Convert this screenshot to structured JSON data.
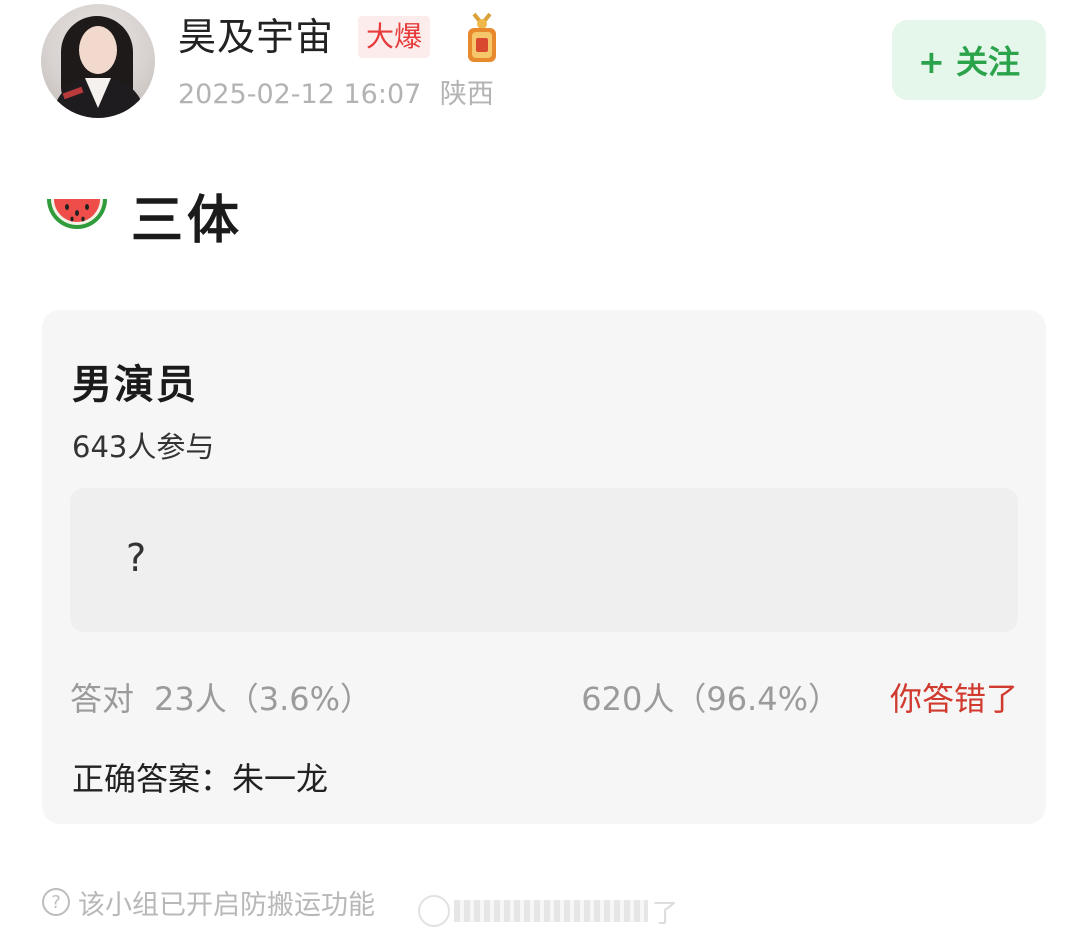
{
  "header": {
    "username": "昊及宇宙",
    "badge": "大爆",
    "timestamp": "2025-02-12 16:07",
    "location": "陕西",
    "follow_label": "+ 关注"
  },
  "post": {
    "title": "三体",
    "title_icon": "watermelon-icon"
  },
  "quiz": {
    "question_title": "男演员",
    "participants": "643人参与",
    "answer_placeholder": "?",
    "correct_label": "答对",
    "correct_stat": "23人（3.6%）",
    "wrong_stat": "620人（96.4%）",
    "wrong_note": "你答错了",
    "correct_answer": "正确答案：朱一龙"
  },
  "footer": {
    "notice": "该小组已开启防搬运功能",
    "watermark_tail": "了"
  },
  "colors": {
    "follow_green": "#2aa34a",
    "badge_red": "#e53b3b",
    "wrong_red": "#d13b2f",
    "card_bg": "#f6f6f6"
  }
}
